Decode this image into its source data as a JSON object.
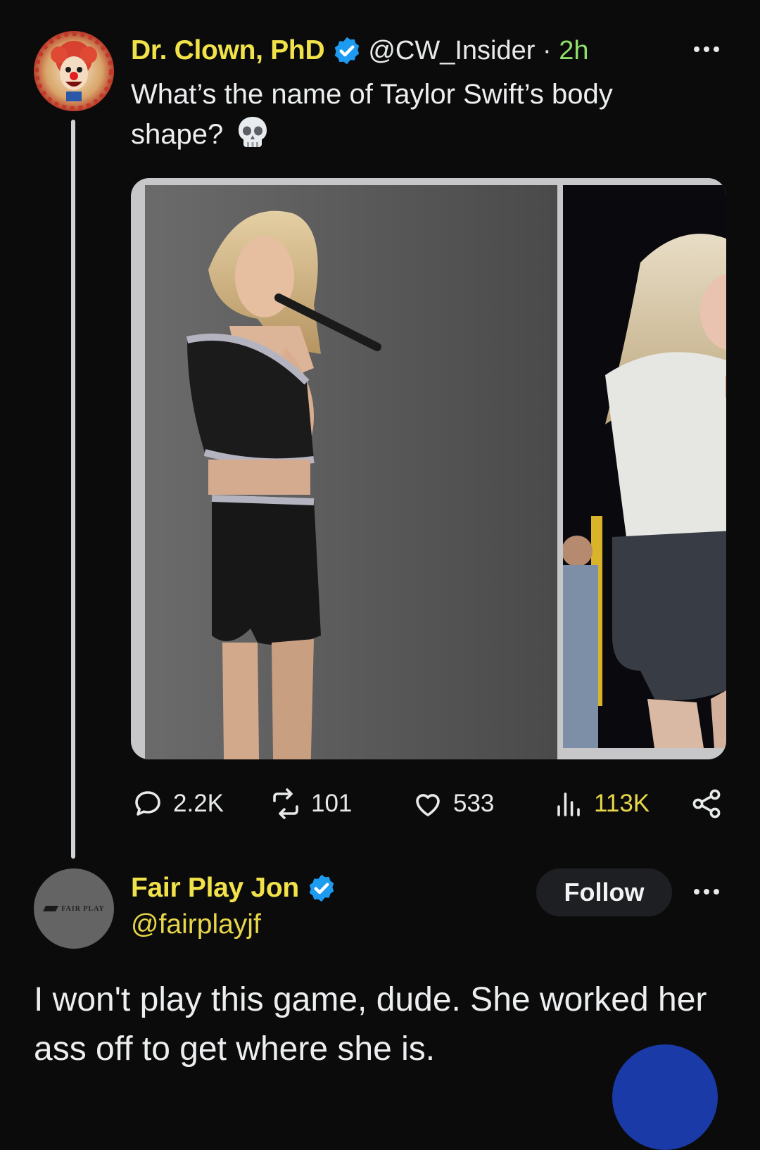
{
  "tweet": {
    "author": {
      "display_name": "Dr. Clown, PhD",
      "handle": "@CW_Insider",
      "separator": " · ",
      "time": "2h",
      "verified_icon": "verified-badge-icon",
      "avatar": "clown-avatar"
    },
    "text": "What’s the name of Taylor Swift’s body shape?",
    "emoji": "skull-icon",
    "media": {
      "left_photo": "performer-black-outfit-photo",
      "right_photo": "performer-white-shirt-photo"
    },
    "stats": {
      "replies": "2.2K",
      "retweets": "101",
      "likes": "533",
      "views": "113K"
    }
  },
  "reply": {
    "author": {
      "display_name": "Fair Play Jon",
      "handle": "@fairplayjf",
      "verified_icon": "verified-badge-icon",
      "avatar_text": "FAIR PLAY"
    },
    "follow_label": "Follow",
    "text": "I won't play this game, dude.  She worked her ass off to get where she is."
  },
  "colors": {
    "background": "#0b0b0b",
    "name_color": "#f2e24a",
    "verified": "#1d9bf0",
    "time_color": "#8fe06a",
    "views_color": "#e8d64a",
    "follow_bg": "#1d1f23"
  }
}
